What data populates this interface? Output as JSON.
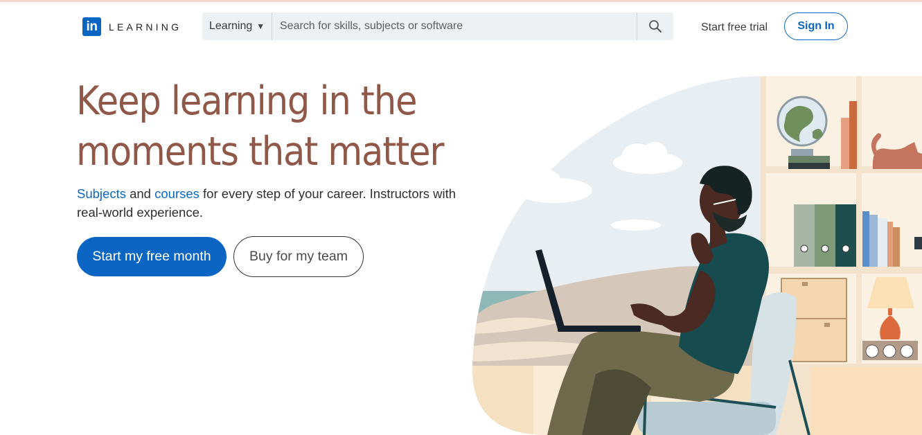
{
  "header": {
    "logo_mark": "in",
    "logo_text": "LEARNING",
    "search": {
      "category": "Learning",
      "placeholder": "Search for skills, subjects or software"
    },
    "trial_link": "Start free trial",
    "signin_label": "Sign In"
  },
  "hero": {
    "title_line1": "Keep learning in the",
    "title_line2": "moments that matter",
    "subtitle": {
      "link1": "Subjects",
      "text1": " and ",
      "link2": "courses",
      "text2": " for every step of your career. Instructors with real-world experience."
    },
    "primary_button": "Start my free month",
    "secondary_button": "Buy for my team"
  },
  "colors": {
    "brand_blue": "#0a66c2",
    "title_brown": "#8f5849"
  }
}
